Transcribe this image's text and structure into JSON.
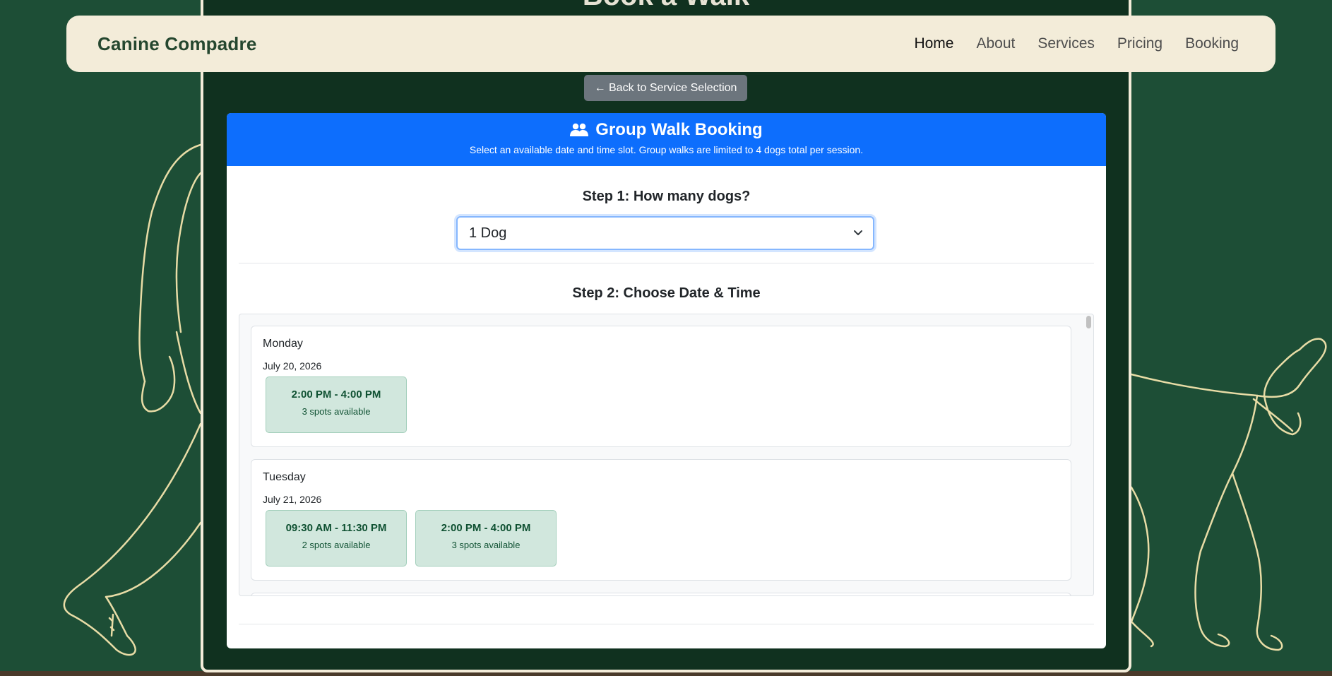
{
  "brand": "Canine Compadre",
  "nav": [
    {
      "label": "Home",
      "active": true
    },
    {
      "label": "About",
      "active": false
    },
    {
      "label": "Services",
      "active": false
    },
    {
      "label": "Pricing",
      "active": false
    },
    {
      "label": "Booking",
      "active": false
    }
  ],
  "page_heading": "Book a Walk",
  "back_button": {
    "icon": "arrow-left-icon",
    "label": "← Back to Service Selection"
  },
  "booking_card": {
    "icon": "people-icon",
    "title": "Group Walk Booking",
    "subtitle": "Select an available date and time slot. Group walks are limited to 4 dogs total per session."
  },
  "step1": {
    "title": "Step 1: How many dogs?",
    "selected": "1 Dog"
  },
  "step2": {
    "title": "Step 2: Choose Date & Time"
  },
  "days": [
    {
      "name": "Monday",
      "date": "July 20, 2026",
      "slots": [
        {
          "time": "2:00 PM - 4:00 PM",
          "spots": "3 spots available"
        }
      ]
    },
    {
      "name": "Tuesday",
      "date": "July 21, 2026",
      "slots": [
        {
          "time": "09:30 AM - 11:30 PM",
          "spots": "2 spots available"
        },
        {
          "time": "2:00 PM - 4:00 PM",
          "spots": "3 spots available"
        }
      ]
    }
  ],
  "colors": {
    "background": "#1d4e36",
    "panel": "#10311f",
    "cream": "#f3ecd9",
    "primary": "#0d6efd",
    "slot_bg": "#d1e7dd",
    "slot_text": "#0f5132",
    "secondary_button": "#6c757d"
  }
}
